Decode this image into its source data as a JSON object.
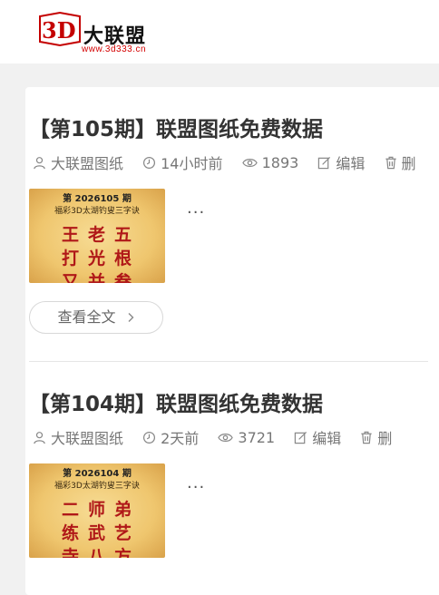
{
  "site": {
    "logo_mark": "3D",
    "logo_name": "大联盟",
    "logo_url": "www.3d333.cn",
    "brand_color": "#c40000"
  },
  "posts": [
    {
      "title": "【第105期】联盟图纸免费数据",
      "author": "大联盟图纸",
      "time": "14小时前",
      "views": "1893",
      "edit_label": "编辑",
      "delete_label": "删",
      "thumb_issue": "第 2026105 期",
      "thumb_sub": "福彩3D太湖钓叟三字诀",
      "thumb_poem": "王老五打光根又并叁",
      "excerpt": "...",
      "readmore_label": "查看全文",
      "readmore_icon": "chevron-right-icon"
    },
    {
      "title": "【第104期】联盟图纸免费数据",
      "author": "大联盟图纸",
      "time": "2天前",
      "views": "3721",
      "edit_label": "编辑",
      "delete_label": "删",
      "thumb_issue": "第 2026104 期",
      "thumb_sub": "福彩3D太湖钓叟三字诀",
      "thumb_poem": "二师弟练武艺寺八方",
      "excerpt": "..."
    }
  ],
  "icons": {
    "author": "user-icon",
    "time": "clock-icon",
    "views": "eye-icon",
    "edit": "edit-icon",
    "delete": "trash-icon"
  }
}
